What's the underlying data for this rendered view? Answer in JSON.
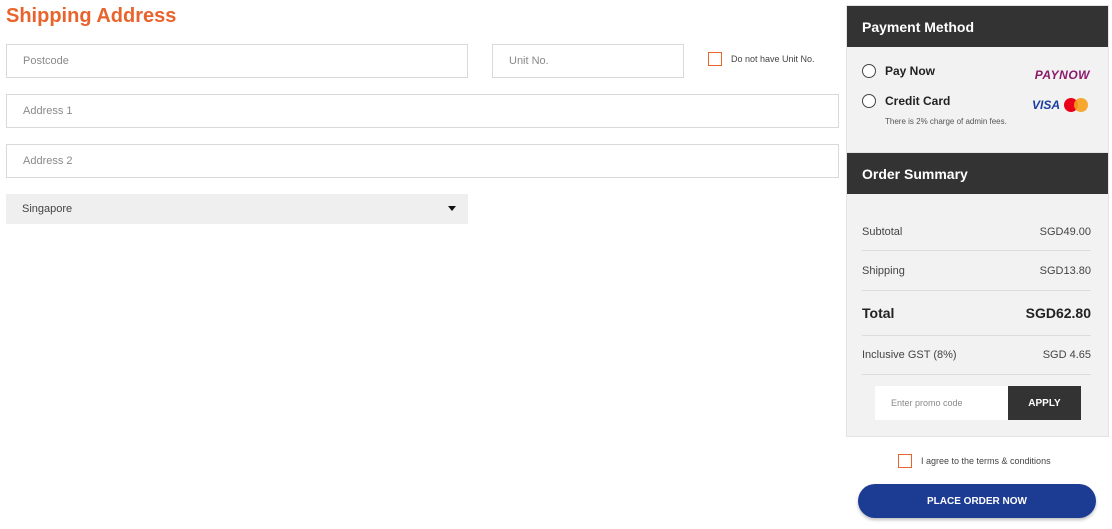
{
  "shipping": {
    "title": "Shipping Address",
    "postcode_placeholder": "Postcode",
    "unit_placeholder": "Unit No.",
    "no_unit_label": "Do not have Unit No.",
    "address1_placeholder": "Address 1",
    "address2_placeholder": "Address 2",
    "country_selected": "Singapore"
  },
  "payment": {
    "title": "Payment Method",
    "options": [
      {
        "label": "Pay Now",
        "logo": "PAYNOW"
      },
      {
        "label": "Credit Card",
        "logo": "VISA"
      }
    ],
    "fee_note": "There is 2% charge of admin fees."
  },
  "summary": {
    "title": "Order Summary",
    "rows": [
      {
        "label": "Subtotal",
        "value": "SGD49.00"
      },
      {
        "label": "Shipping",
        "value": "SGD13.80"
      },
      {
        "label": "Total",
        "value": "SGD62.80"
      },
      {
        "label": "Inclusive GST (8%)",
        "value": "SGD 4.65"
      }
    ],
    "promo_placeholder": "Enter promo code",
    "apply_label": "APPLY"
  },
  "checkout": {
    "terms_label": "I agree to the terms & conditions",
    "place_order_label": "PLACE ORDER NOW"
  },
  "colors": {
    "accent": "#e8642c",
    "header_dark": "#333333",
    "button_blue": "#1c3c94"
  }
}
